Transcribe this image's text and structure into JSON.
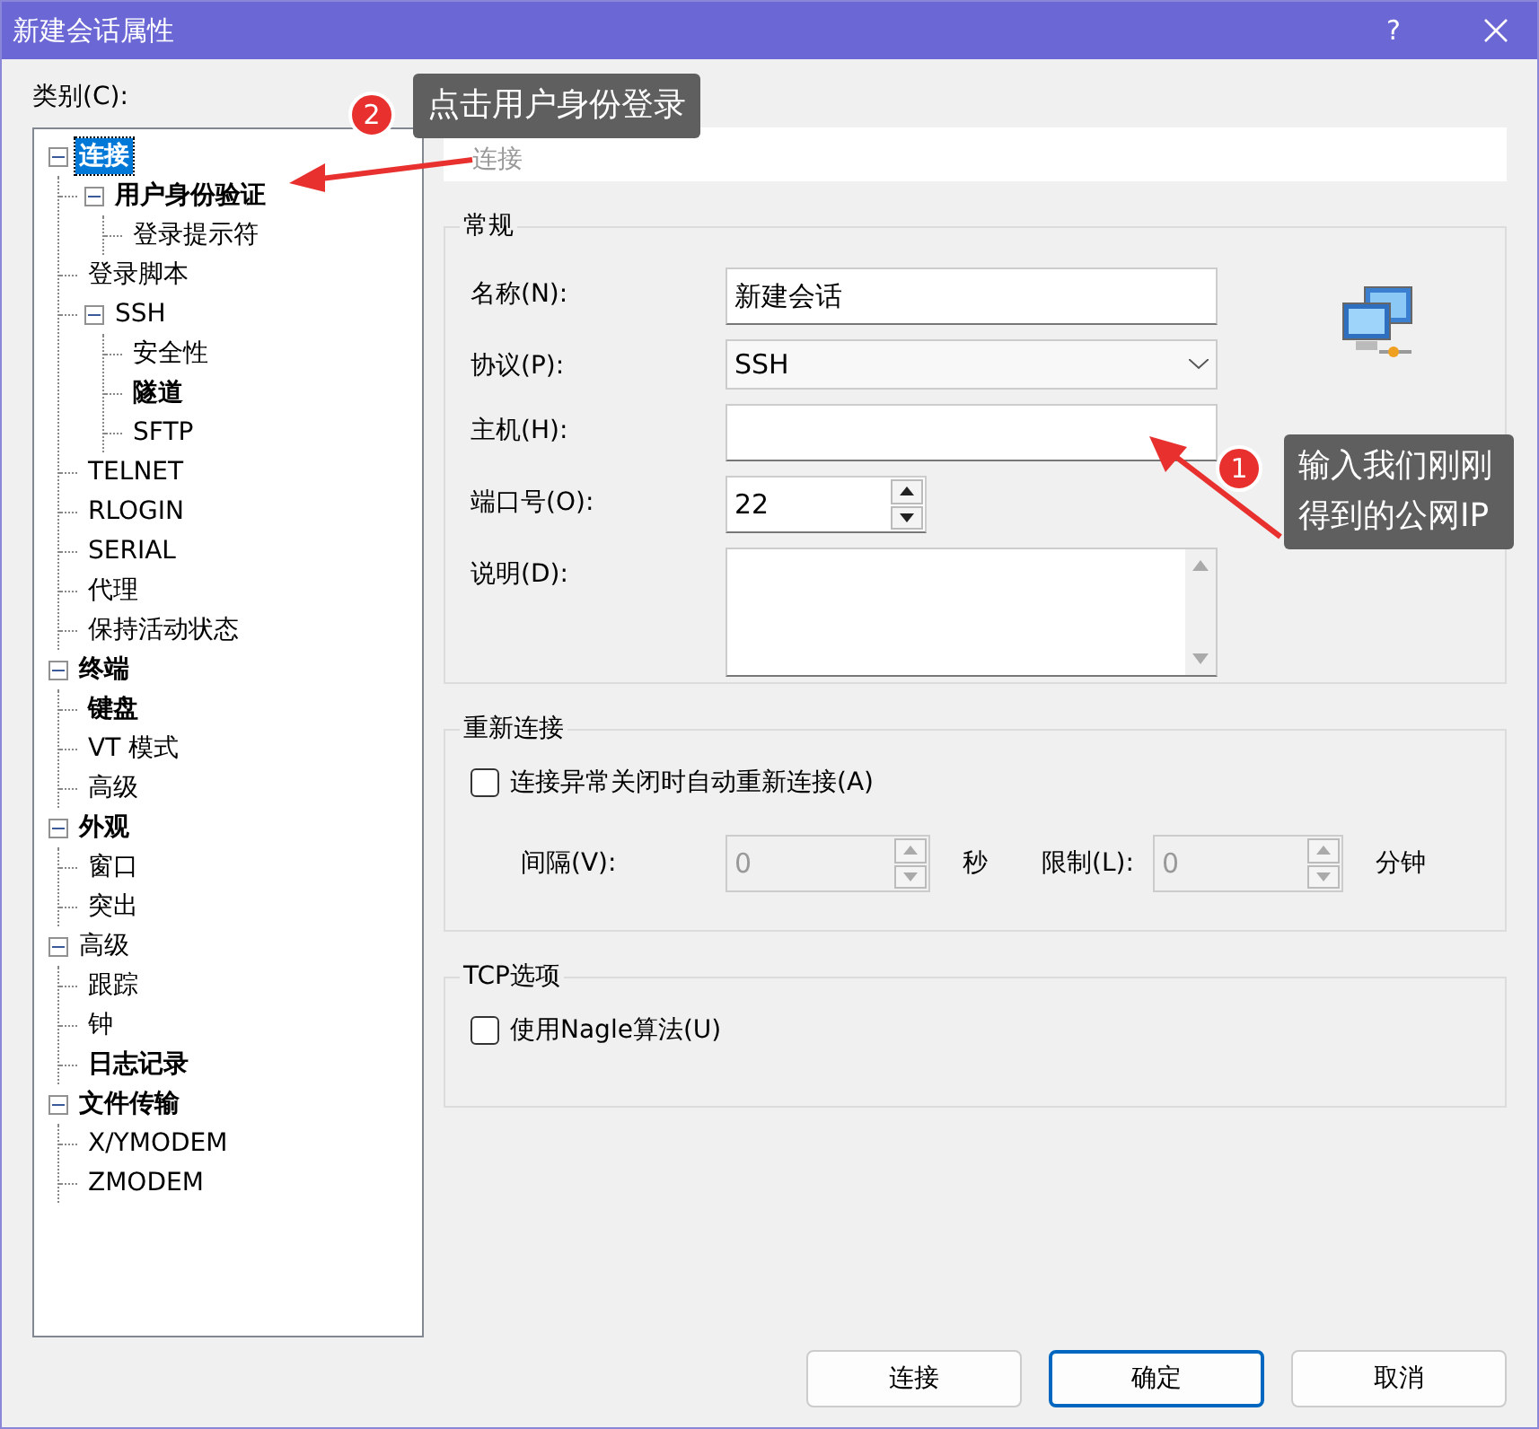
{
  "window": {
    "title": "新建会话属性",
    "help": "?"
  },
  "category_label": "类别(C):",
  "tree": [
    {
      "label": "连接",
      "bold": true,
      "selected": true,
      "expanded": true,
      "children": [
        {
          "label": "用户身份验证",
          "bold": true,
          "selected": false,
          "expanded": true,
          "children": [
            {
              "label": "登录提示符",
              "bold": false,
              "selected": false
            }
          ]
        },
        {
          "label": "登录脚本",
          "bold": false,
          "selected": false
        },
        {
          "label": "SSH",
          "bold": false,
          "selected": false,
          "expanded": true,
          "children": [
            {
              "label": "安全性",
              "bold": false,
              "selected": false
            },
            {
              "label": "隧道",
              "bold": true,
              "selected": false
            },
            {
              "label": "SFTP",
              "bold": false,
              "selected": false
            }
          ]
        },
        {
          "label": "TELNET",
          "bold": false,
          "selected": false
        },
        {
          "label": "RLOGIN",
          "bold": false,
          "selected": false
        },
        {
          "label": "SERIAL",
          "bold": false,
          "selected": false
        },
        {
          "label": "代理",
          "bold": false,
          "selected": false
        },
        {
          "label": "保持活动状态",
          "bold": false,
          "selected": false
        }
      ]
    },
    {
      "label": "终端",
      "bold": true,
      "selected": false,
      "expanded": true,
      "children": [
        {
          "label": "键盘",
          "bold": true,
          "selected": false
        },
        {
          "label": "VT 模式",
          "bold": false,
          "selected": false
        },
        {
          "label": "高级",
          "bold": false,
          "selected": false
        }
      ]
    },
    {
      "label": "外观",
      "bold": true,
      "selected": false,
      "expanded": true,
      "children": [
        {
          "label": "窗口",
          "bold": false,
          "selected": false
        },
        {
          "label": "突出",
          "bold": false,
          "selected": false
        }
      ]
    },
    {
      "label": "高级",
      "bold": false,
      "selected": false,
      "expanded": true,
      "children": [
        {
          "label": "跟踪",
          "bold": false,
          "selected": false
        },
        {
          "label": "钟",
          "bold": false,
          "selected": false
        },
        {
          "label": "日志记录",
          "bold": true,
          "selected": false
        }
      ]
    },
    {
      "label": "文件传输",
      "bold": true,
      "selected": false,
      "expanded": true,
      "children": [
        {
          "label": "X/YMODEM",
          "bold": false,
          "selected": false
        },
        {
          "label": "ZMODEM",
          "bold": false,
          "selected": false
        }
      ]
    }
  ],
  "panel_header": "连接",
  "general": {
    "title": "常规",
    "fields": [
      {
        "kind": "text",
        "label": "名称(N):",
        "value": "新建会话"
      },
      {
        "kind": "select",
        "label": "协议(P):",
        "value": "SSH"
      },
      {
        "kind": "text",
        "label": "主机(H):"
      },
      {
        "kind": "spin",
        "label": "端口号(O):",
        "value": "22"
      },
      {
        "kind": "textarea",
        "label": "说明(D):"
      }
    ]
  },
  "reconnect": {
    "title": "重新连接",
    "checkbox": {
      "label": "连接异常关闭时自动重新连接(A)",
      "checked": false
    },
    "spins": [
      {
        "label": "间隔(V):",
        "value": "0",
        "unit": "秒",
        "disabled": true
      },
      {
        "label": "限制(L):",
        "value": "0",
        "unit": "分钟",
        "disabled": true
      }
    ]
  },
  "tcp": {
    "title": "TCP选项",
    "checkbox": {
      "label": "使用Nagle算法(U)",
      "checked": false
    }
  },
  "buttons": [
    {
      "label": "连接",
      "focused": false
    },
    {
      "label": "确定",
      "focused": true
    },
    {
      "label": "取消",
      "focused": false
    }
  ],
  "annotations": [
    {
      "number": "2",
      "text": "点击用户身份登录"
    },
    {
      "number": "1",
      "text": "输入我们刚刚得到的公网IP"
    }
  ]
}
